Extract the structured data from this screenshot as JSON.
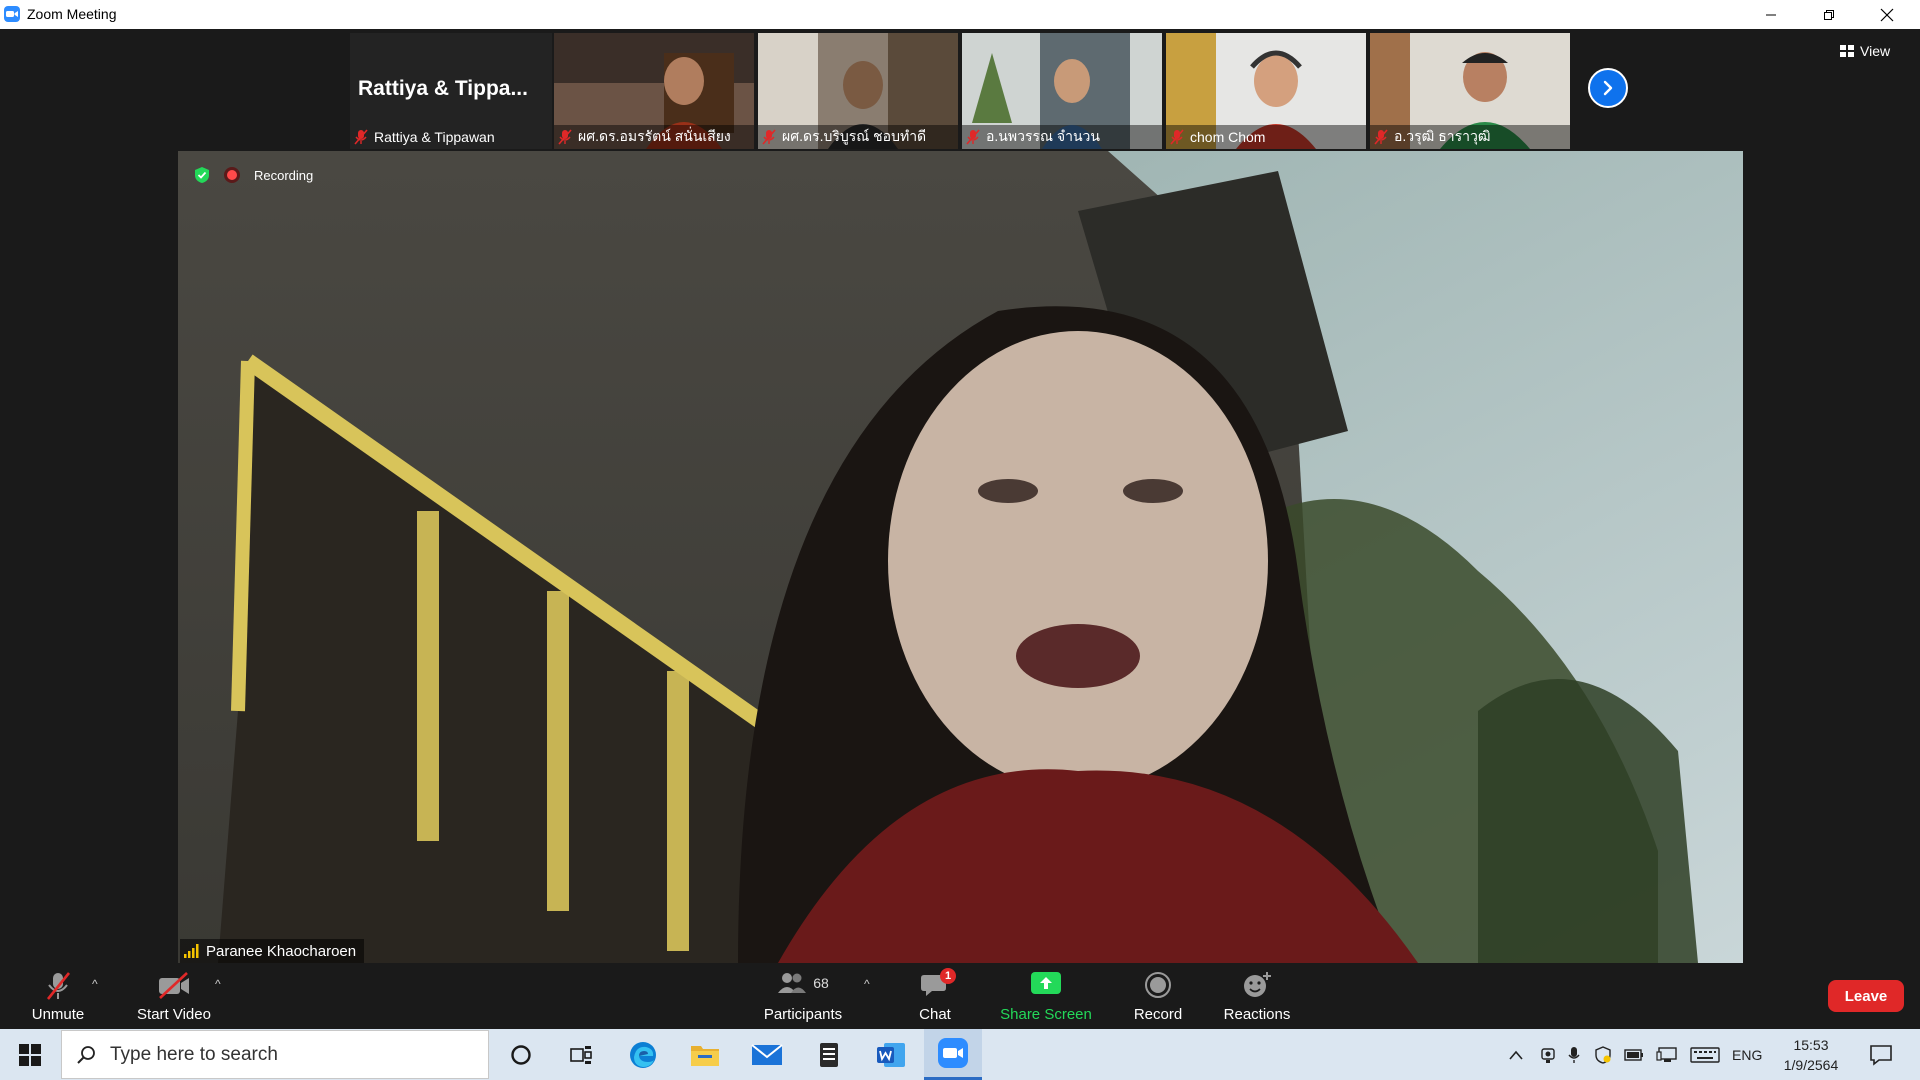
{
  "window": {
    "title": "Zoom Meeting"
  },
  "strip": {
    "name_tile": {
      "big_name": "Rattiya  &  Tippa...",
      "label": "Rattiya & Tippawan"
    },
    "participants": [
      {
        "label": "ผศ.ดร.อมรรัตน์ สนั่นเสียง"
      },
      {
        "label": "ผศ.ดร.บริบูรณ์ ชอบทำดี"
      },
      {
        "label": "อ.นพวรรณ จำนวน"
      },
      {
        "label": "chom Chom"
      },
      {
        "label": "อ.วรุฒิ ธาราวุฒิ"
      }
    ]
  },
  "view_label": "View",
  "recording_label": "Recording",
  "speaker_name": "Paranee Khaocharoen",
  "toolbar": {
    "unmute": "Unmute",
    "start_video": "Start Video",
    "participants_label": "Participants",
    "participants_count": "68",
    "chat": "Chat",
    "chat_badge": "1",
    "share_screen": "Share Screen",
    "record": "Record",
    "reactions": "Reactions",
    "leave": "Leave"
  },
  "taskbar": {
    "search_placeholder": "Type here to search",
    "lang": "ENG",
    "time": "15:53",
    "date": "1/9/2564"
  },
  "colors": {
    "accent": "#2d8cff",
    "share_green": "#23d959",
    "leave_red": "#e02828",
    "badge_red": "#e02828"
  }
}
